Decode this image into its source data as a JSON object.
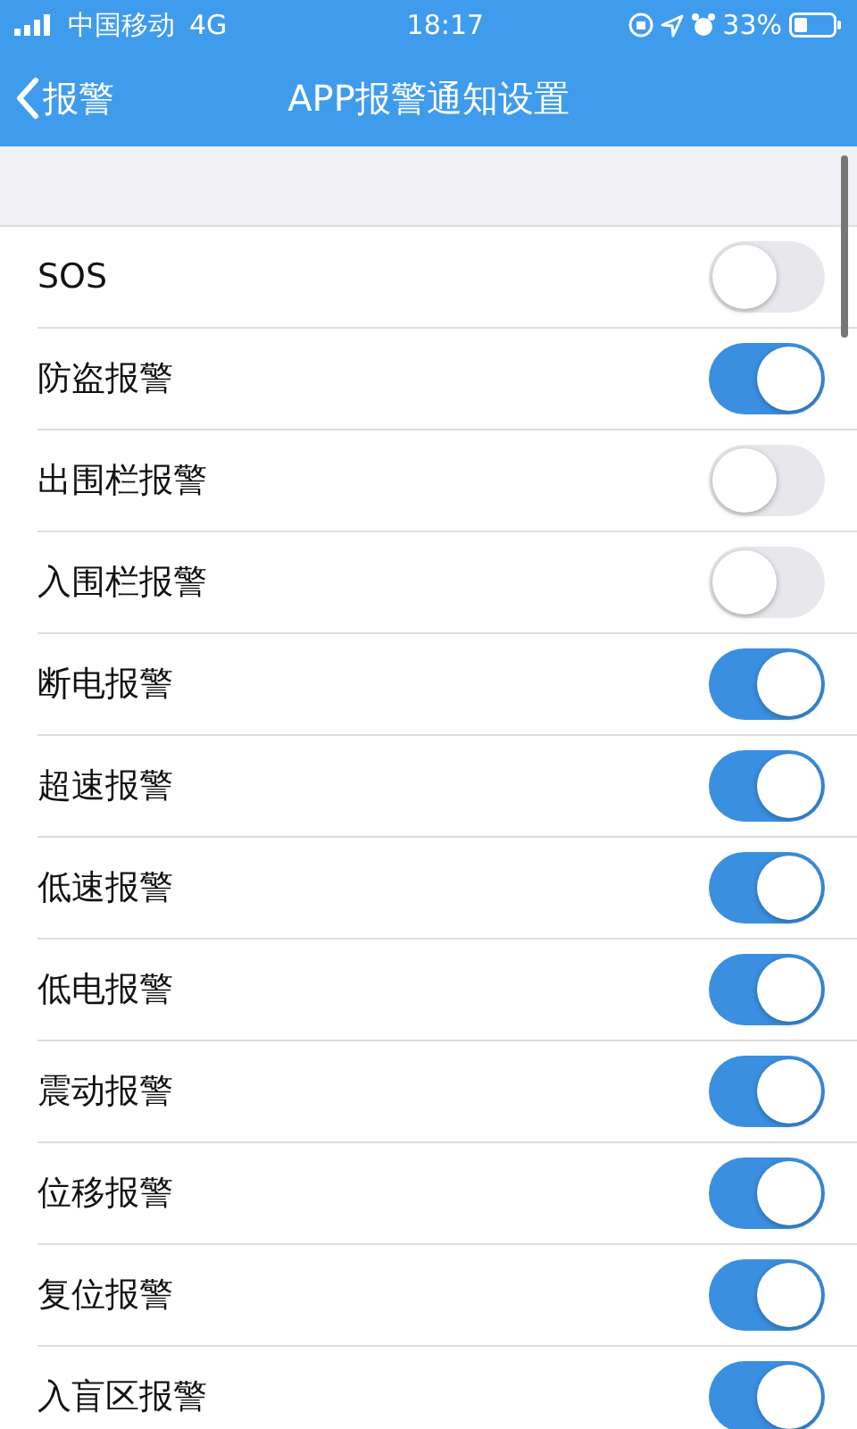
{
  "status_bar": {
    "carrier": "中国移动",
    "network": "4G",
    "time": "18:17",
    "battery": "33%"
  },
  "nav": {
    "back": "报警",
    "title": "APP报警通知设置"
  },
  "settings": [
    {
      "label": "SOS",
      "on": false
    },
    {
      "label": "防盗报警",
      "on": true
    },
    {
      "label": "出围栏报警",
      "on": false
    },
    {
      "label": "入围栏报警",
      "on": false
    },
    {
      "label": "断电报警",
      "on": true
    },
    {
      "label": "超速报警",
      "on": true
    },
    {
      "label": "低速报警",
      "on": true
    },
    {
      "label": "低电报警",
      "on": true
    },
    {
      "label": "震动报警",
      "on": true
    },
    {
      "label": "位移报警",
      "on": true
    },
    {
      "label": "复位报警",
      "on": true
    },
    {
      "label": "入盲区报警",
      "on": true
    }
  ]
}
